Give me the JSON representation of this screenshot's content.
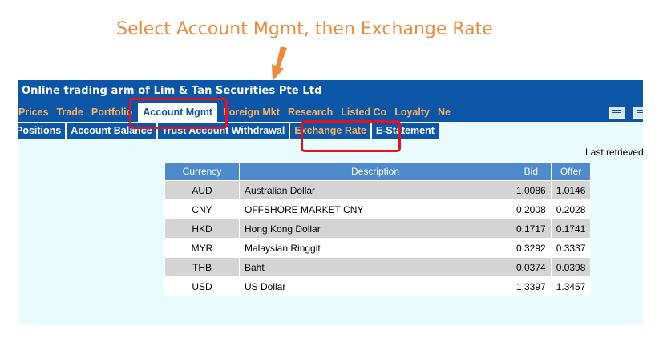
{
  "instruction": "Select Account Mgmt, then Exchange Rate",
  "banner_title": "Online trading arm of Lim & Tan Securities Pte Ltd",
  "top_nav": [
    {
      "label": "Prices",
      "active": false
    },
    {
      "label": "Trade",
      "active": false
    },
    {
      "label": "Portfolio",
      "active": false
    },
    {
      "label": "Account Mgmt",
      "active": true
    },
    {
      "label": "Foreign Mkt",
      "active": false
    },
    {
      "label": "Research",
      "active": false
    },
    {
      "label": "Listed Co",
      "active": false
    },
    {
      "label": "Loyalty",
      "active": false
    },
    {
      "label": "Ne",
      "active": false
    }
  ],
  "sub_nav": [
    {
      "label": "Positions",
      "active": false
    },
    {
      "label": "Account Balance",
      "active": false
    },
    {
      "label": "Trust Account Withdrawal",
      "active": false
    },
    {
      "label": "Exchange Rate",
      "active": true
    },
    {
      "label": "E-Statement",
      "active": false
    }
  ],
  "last_retrieved_label": "Last retrieved",
  "table": {
    "headers": [
      "Currency",
      "Description",
      "Bid",
      "Offer"
    ],
    "rows": [
      {
        "currency": "AUD",
        "description": "Australian Dollar",
        "bid": "1.0086",
        "offer": "1.0146"
      },
      {
        "currency": "CNY",
        "description": "OFFSHORE MARKET CNY",
        "bid": "0.2008",
        "offer": "0.2028"
      },
      {
        "currency": "HKD",
        "description": "Hong Kong Dollar",
        "bid": "0.1717",
        "offer": "0.1741"
      },
      {
        "currency": "MYR",
        "description": "Malaysian Ringgit",
        "bid": "0.3292",
        "offer": "0.3337"
      },
      {
        "currency": "THB",
        "description": "Baht",
        "bid": "0.0374",
        "offer": "0.0398"
      },
      {
        "currency": "USD",
        "description": "US Dollar",
        "bid": "1.3397",
        "offer": "1.3457"
      }
    ]
  },
  "colors": {
    "accent_orange": "#ef8a3c",
    "nav_blue": "#0b56a7",
    "header_blue": "#4d8bcd",
    "highlight_red": "#e8101d",
    "page_bg": "#e9fbfd"
  }
}
